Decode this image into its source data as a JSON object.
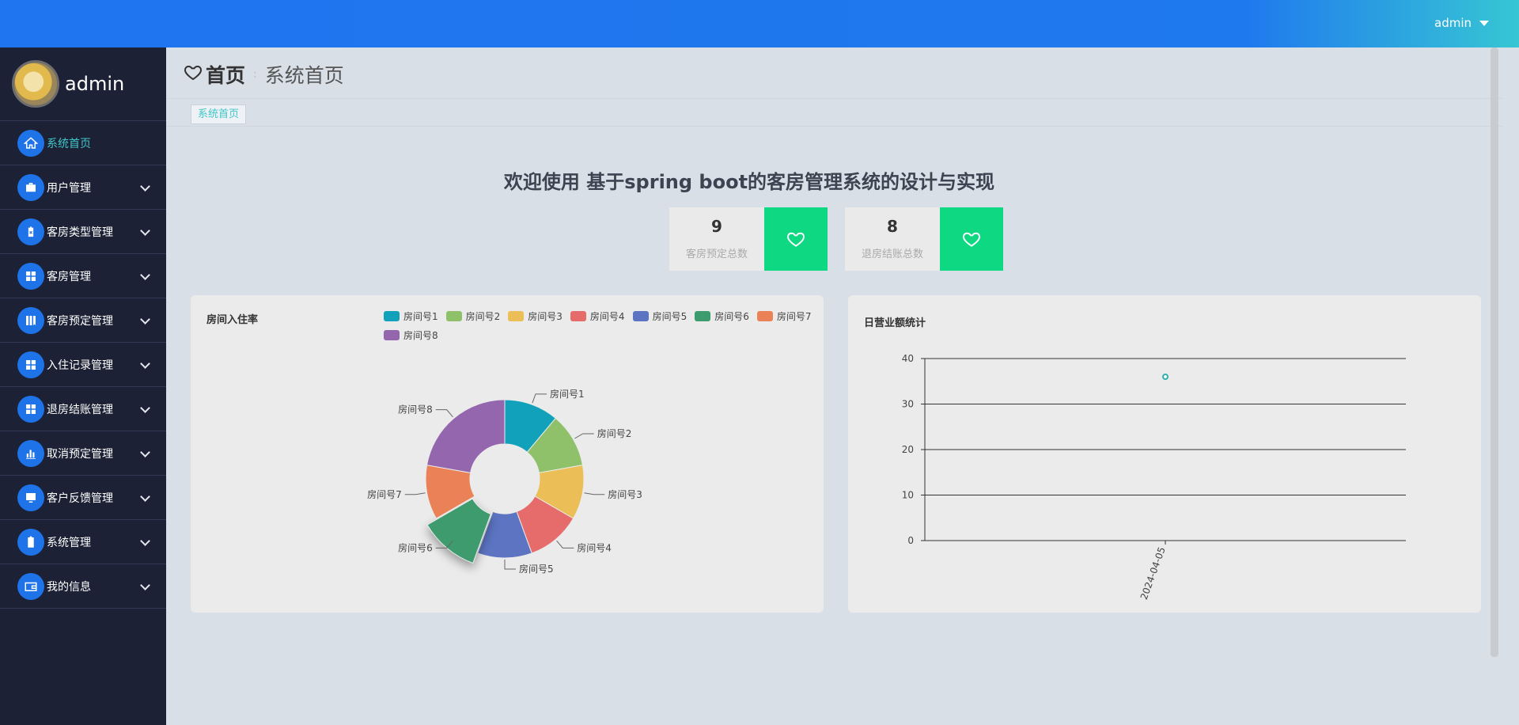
{
  "topbar": {
    "user": "admin"
  },
  "sidebar": {
    "profile_name": "admin",
    "items": [
      {
        "label": "系统首页",
        "icon": "home-icon",
        "active": true,
        "expandable": false
      },
      {
        "label": "用户管理",
        "icon": "briefcase-icon",
        "active": false,
        "expandable": true
      },
      {
        "label": "客房类型管理",
        "icon": "clipboard-x-icon",
        "active": false,
        "expandable": true
      },
      {
        "label": "客房管理",
        "icon": "grid-icon",
        "active": false,
        "expandable": true
      },
      {
        "label": "客房预定管理",
        "icon": "bookmark-columns-icon",
        "active": false,
        "expandable": true
      },
      {
        "label": "入住记录管理",
        "icon": "grid-icon",
        "active": false,
        "expandable": true
      },
      {
        "label": "退房结账管理",
        "icon": "grid-icon",
        "active": false,
        "expandable": true
      },
      {
        "label": "取消预定管理",
        "icon": "bar-chart-icon",
        "active": false,
        "expandable": true
      },
      {
        "label": "客户反馈管理",
        "icon": "monitor-icon",
        "active": false,
        "expandable": true
      },
      {
        "label": "系统管理",
        "icon": "clipboard-icon",
        "active": false,
        "expandable": true
      },
      {
        "label": "我的信息",
        "icon": "wallet-icon",
        "active": false,
        "expandable": true
      }
    ]
  },
  "breadcrumb": {
    "home": "首页",
    "current": "系统首页"
  },
  "tag": "系统首页",
  "welcome": "欢迎使用 基于spring boot的客房管理系统的设计与实现",
  "stats": [
    {
      "value": "9",
      "label": "客房预定总数"
    },
    {
      "value": "8",
      "label": "退房结账总数"
    }
  ],
  "colors": {
    "accent": "#1f74ef",
    "active_text": "#3fc7c8",
    "stat_green": "#0ed882",
    "sidebar_bg": "#1d2135"
  },
  "chart_data": [
    {
      "type": "pie",
      "title": "房间入住率",
      "legend_position": "top-right",
      "donut": true,
      "categories": [
        "房间号1",
        "房间号2",
        "房间号3",
        "房间号4",
        "房间号5",
        "房间号6",
        "房间号7",
        "房间号8"
      ],
      "values": [
        1,
        1,
        1,
        1,
        1,
        1,
        1,
        2
      ],
      "colors": [
        "#11a1bb",
        "#8ec16a",
        "#ebbe57",
        "#e66b6b",
        "#5c74c2",
        "#3d9b6e",
        "#ea8157",
        "#9366ad"
      ],
      "highlighted": "房间号6"
    },
    {
      "type": "scatter",
      "title": "日营业额统计",
      "x": [
        "2024-04-05"
      ],
      "values": [
        36
      ],
      "ylim": [
        0,
        40
      ],
      "yticks": [
        0,
        10,
        20,
        30,
        40
      ],
      "grid": true,
      "point_color": "#2bb3ac"
    }
  ]
}
